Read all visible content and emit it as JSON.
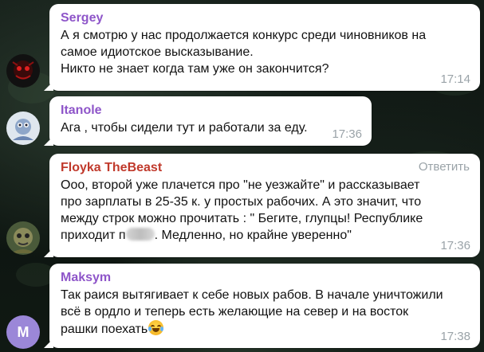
{
  "messages": [
    {
      "sender": "Sergey",
      "sender_color": "#8e55c9",
      "lines": [
        "А я смотрю у нас продолжается конкурс среди чиновников на",
        "самое идиотское высказывание.",
        "Никто не знает когда там уже он закончится?"
      ],
      "time": "17:14"
    },
    {
      "sender": "Itanole",
      "sender_color": "#8e55c9",
      "lines": [
        "Ага , чтобы сидели тут и работали за еду."
      ],
      "time": "17:36"
    },
    {
      "sender": "Floyka TheBeast",
      "sender_color": "#c0392b",
      "reply_label": "Ответить",
      "lines": [
        "Ооо, второй уже плачется про \"не уезжайте\" и рассказывает",
        "про зарплаты в 25-35 к. у простых рабочих. А это значит, что",
        "между строк можно прочитать : \" Бегите, глупцы! Республике",
        "приходит п",
        ". Медленно, но крайне уверенно\""
      ],
      "time": "17:36"
    },
    {
      "sender": "Maksym",
      "sender_color": "#8e55c9",
      "lines": [
        "Так раися вытягивает к себе новых рабов. В начале уничтожили",
        "всё в ордло и теперь есть желающие на север и на восток",
        "рашки поехать"
      ],
      "time": "17:38",
      "avatar_letter": "M",
      "avatar_color": "#9b87d8"
    }
  ],
  "icons": {
    "emoji": "laughing-tears-emoji"
  }
}
